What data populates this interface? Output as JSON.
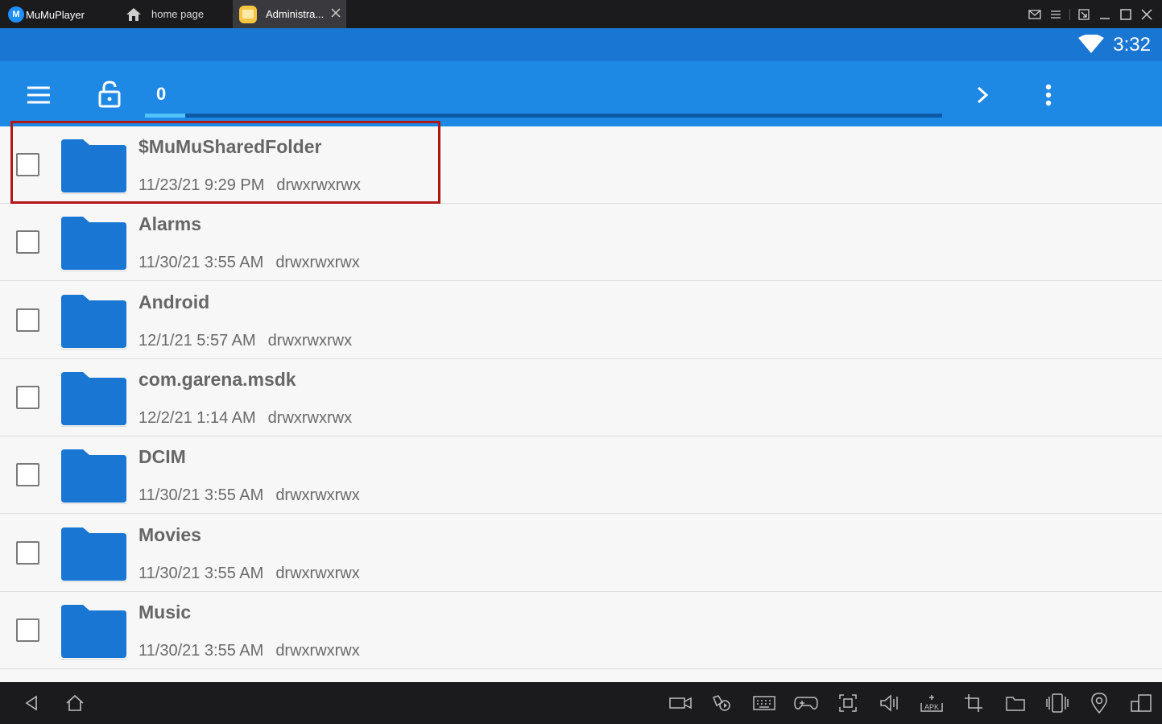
{
  "window": {
    "brand": "MuMuPlayer",
    "brand_logo": "MuMu",
    "tabs": [
      {
        "label": "home page",
        "icon": "home-icon"
      },
      {
        "label": "Administra...",
        "icon": "file-manager-app-icon",
        "active": true
      }
    ],
    "controls": [
      "mail-icon",
      "menu-icon",
      "minimize-to-corner-icon",
      "minimize-icon",
      "maximize-icon",
      "close-icon"
    ]
  },
  "statusbar": {
    "time": "3:32",
    "wifi_icon": "wifi-icon"
  },
  "toolbar": {
    "breadcrumb": "0",
    "path_progress": 0.05,
    "colors": {
      "statusbar": "#1976d2",
      "toolbar": "#1e88e5",
      "path_track": "#0d5aa7",
      "path_fill": "#4fc3f7",
      "folder": "#1976d2",
      "highlight": "#b01818"
    }
  },
  "files": [
    {
      "name": "$MuMuSharedFolder",
      "date": "11/23/21 9:29 PM",
      "perm": "drwxrwxrwx",
      "highlighted": true
    },
    {
      "name": "Alarms",
      "date": "11/30/21 3:55 AM",
      "perm": "drwxrwxrwx"
    },
    {
      "name": "Android",
      "date": "12/1/21 5:57 AM",
      "perm": "drwxrwxrwx"
    },
    {
      "name": "com.garena.msdk",
      "date": "12/2/21 1:14 AM",
      "perm": "drwxrwxrwx"
    },
    {
      "name": "DCIM",
      "date": "11/30/21 3:55 AM",
      "perm": "drwxrwxrwx"
    },
    {
      "name": "Movies",
      "date": "11/30/21 3:55 AM",
      "perm": "drwxrwxrwx"
    },
    {
      "name": "Music",
      "date": "11/30/21 3:55 AM",
      "perm": "drwxrwxrwx"
    }
  ],
  "bottombar": {
    "left": [
      "back-icon",
      "home-icon"
    ],
    "right": [
      "video-record-icon",
      "gamepad-settings-icon",
      "keyboard-icon",
      "gamepad-icon",
      "screenshot-icon",
      "volume-icon",
      "apk-install-icon",
      "crop-icon",
      "folder-icon",
      "shake-icon",
      "location-icon",
      "multi-window-icon"
    ]
  }
}
